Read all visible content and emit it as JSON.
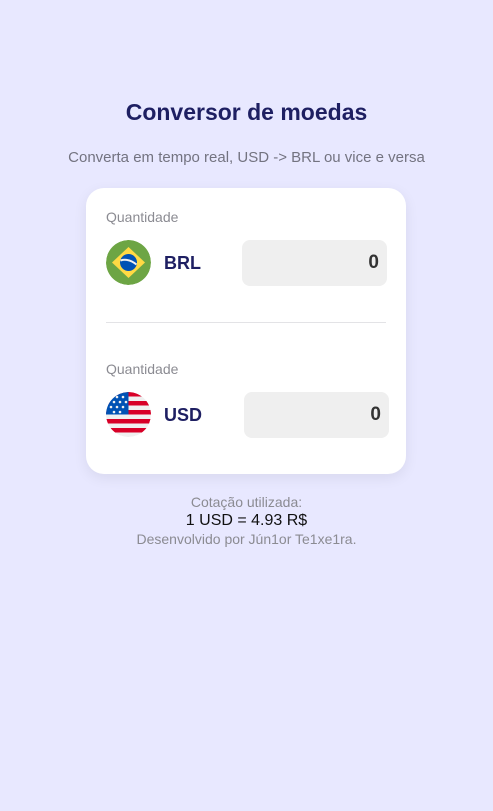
{
  "header": {
    "title": "Conversor de moedas",
    "subtitle": "Converta em tempo real, USD -> BRL ou vice e versa"
  },
  "converter": {
    "from": {
      "label": "Quantidade",
      "code": "BRL",
      "flag": "brazil-flag-icon",
      "value": "0"
    },
    "to": {
      "label": "Quantidade",
      "code": "USD",
      "flag": "usa-flag-icon",
      "value": "0"
    }
  },
  "footer": {
    "rate_label": "Cotação utilizada:",
    "rate_value": "1 USD = 4.93 R$",
    "credits": "Desenvolvido por Jún1or Te1xe1ra."
  },
  "colors": {
    "background": "#e8e8ff",
    "title": "#1e1f62",
    "card": "#ffffff",
    "input_bg": "#efefef"
  }
}
